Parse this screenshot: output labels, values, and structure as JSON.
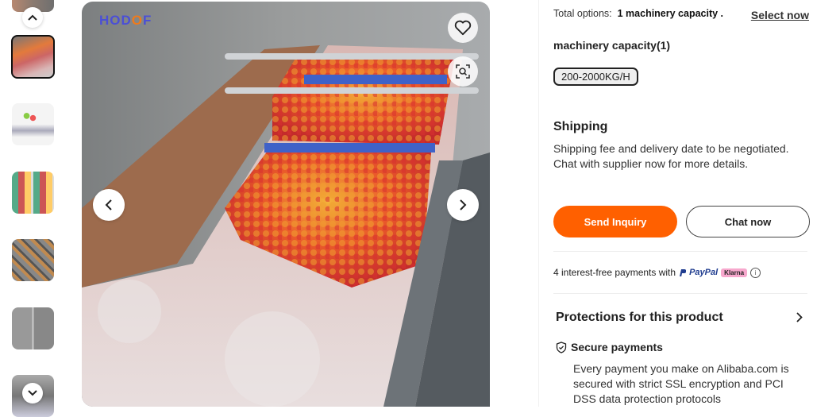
{
  "gallery": {
    "thumbnails": [
      {
        "label": "washing line top view",
        "active": true
      },
      {
        "label": "machine with vegetables",
        "active": false
      },
      {
        "label": "produce collage",
        "active": false
      },
      {
        "label": "conveyor trays",
        "active": false
      },
      {
        "label": "machine parts collage",
        "active": false
      },
      {
        "label": "conveyor bottom view",
        "active": false
      }
    ],
    "logo_text_pre": "HOD",
    "logo_text_o": "O",
    "logo_text_post": "F"
  },
  "options": {
    "total_label": "Total options:",
    "total_value": "1 machinery capacity .",
    "select_now": "Select now",
    "capacity_title": "machinery capacity(1)",
    "capacity_chip": "200-2000KG/H"
  },
  "shipping": {
    "title": "Shipping",
    "text": "Shipping fee and delivery date to be negotiated. Chat with supplier now for more details."
  },
  "actions": {
    "send_inquiry": "Send Inquiry",
    "chat_now": "Chat now"
  },
  "payments": {
    "text": "4 interest-free payments with",
    "paypal": "PayPal",
    "klarna": "Klarna",
    "info": "i"
  },
  "protections": {
    "title": "Protections for this product",
    "secure_title": "Secure payments",
    "secure_text": "Every payment you make on Alibaba.com is secured with strict SSL encryption and PCI DSS data protection protocols"
  },
  "colors": {
    "accent": "#ff6000",
    "paypal": "#1f3c8f",
    "klarna": "#f7a8cd"
  }
}
